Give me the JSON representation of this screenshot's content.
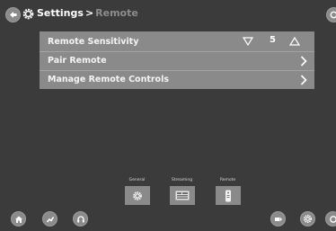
{
  "header": {
    "breadcrumb_root": "Settings",
    "breadcrumb_separator": ">",
    "breadcrumb_current": "Remote",
    "icons": [
      "back-arrow-icon",
      "gear-icon"
    ]
  },
  "menu": {
    "items": [
      {
        "label": "Remote Sensitivity",
        "value": "5",
        "control": "stepper"
      },
      {
        "label": "Pair Remote",
        "control": "chevron"
      },
      {
        "label": "Manage Remote Controls",
        "control": "chevron"
      }
    ]
  },
  "tabs": [
    {
      "label": "General",
      "icon": "gear-icon"
    },
    {
      "label": "Streaming",
      "icon": "streaming-icon"
    },
    {
      "label": "Remote",
      "icon": "remote-icon"
    }
  ],
  "bottom_bar": {
    "icons": [
      "home-icon",
      "chart-icon",
      "headset-icon",
      "input-icon",
      "gear-icon",
      "power-icon"
    ]
  },
  "colors": {
    "background": "#3b3b3b",
    "panel": "#8a8a8a",
    "text": "#f4f4f4",
    "breadcrumb_current": "#8c8c8c"
  }
}
